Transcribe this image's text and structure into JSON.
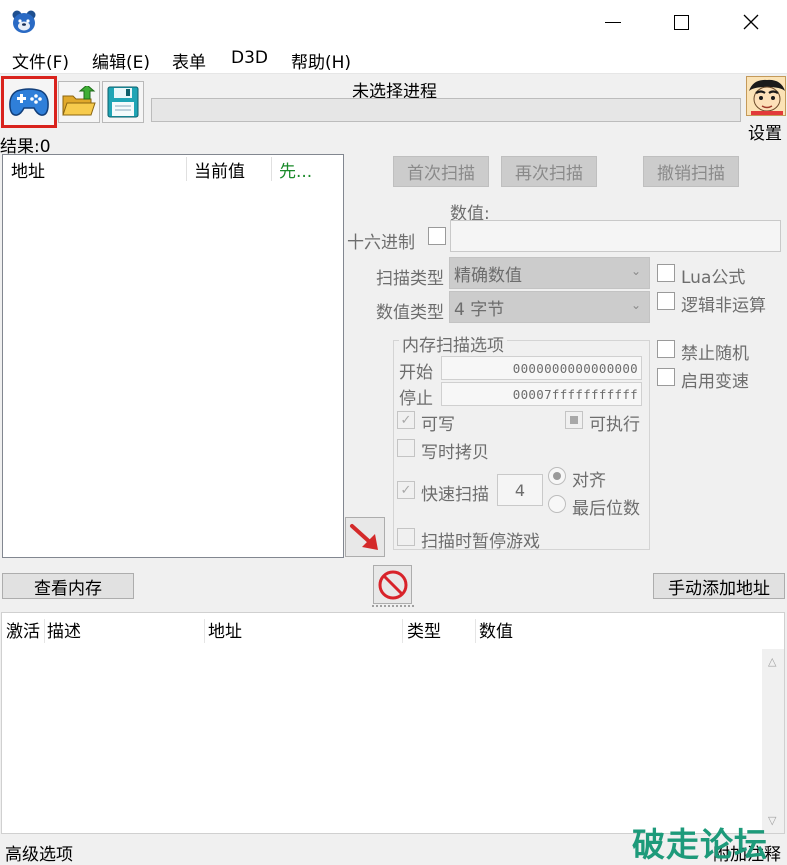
{
  "window": {
    "title": "",
    "minimize_icon": "minimize-icon",
    "maximize_icon": "maximize-icon",
    "close_icon": "close-icon"
  },
  "menu": {
    "items": [
      "文件(F)",
      "编辑(E)",
      "表单",
      "D3D",
      "帮助(H)"
    ]
  },
  "toolbar": {
    "process_label": "未选择进程",
    "settings_label": "设置"
  },
  "results": {
    "label": "结果:0",
    "columns": [
      "地址",
      "当前值",
      "先..."
    ]
  },
  "scan": {
    "first_scan": "首次扫描",
    "next_scan": "再次扫描",
    "undo_scan": "撤销扫描",
    "value_label": "数值:",
    "hex_label": "十六进制",
    "scan_type_label": "扫描类型",
    "scan_type_value": "精确数值",
    "value_type_label": "数值类型",
    "value_type_value": "4 字节",
    "lua_formula": "Lua公式",
    "logical_not": "逻辑非运算",
    "disable_random": "禁止随机",
    "enable_speedhack": "启用变速"
  },
  "memory_options": {
    "title": "内存扫描选项",
    "start_label": "开始",
    "start_value": "0000000000000000",
    "stop_label": "停止",
    "stop_value": "00007fffffffffff",
    "writable": "可写",
    "executable": "可执行",
    "copy_on_write": "写时拷贝",
    "fast_scan": "快速扫描",
    "fast_scan_value": "4",
    "align": "对齐",
    "last_digits": "最后位数",
    "pause_game": "扫描时暂停游戏"
  },
  "actions": {
    "view_memory": "查看内存",
    "add_address_manually": "手动添加地址"
  },
  "address_list": {
    "columns": [
      "激活",
      "描述",
      "地址",
      "类型",
      "数值"
    ]
  },
  "status": {
    "advanced_options": "高级选项",
    "right_text": "附加注释"
  },
  "watermark": "破走论坛",
  "colors": {
    "highlight": "#d9231d",
    "gamepad_blue": "#2f7fd9",
    "arrow_red": "#d42a2a",
    "stop_red": "#d8232a",
    "watermark_green": "#1d9a7a"
  }
}
